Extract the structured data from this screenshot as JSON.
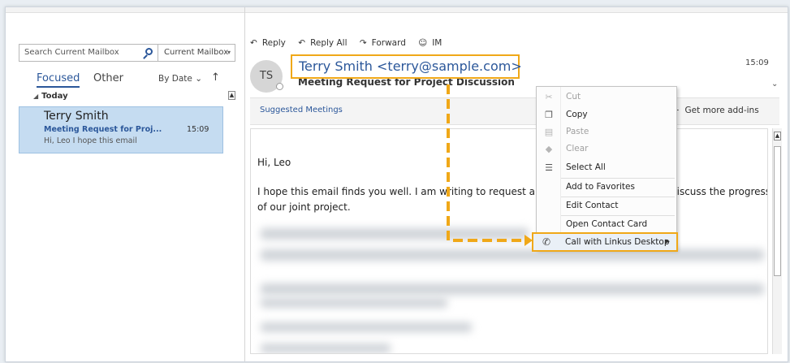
{
  "search": {
    "placeholder": "Search Current Mailbox",
    "scope": "Current Mailbox"
  },
  "tabs": {
    "focused": "Focused",
    "other": "Other"
  },
  "sort": {
    "label": "By Date",
    "arrow": "↑"
  },
  "group": {
    "label": "Today"
  },
  "mail_item": {
    "sender": "Terry Smith",
    "subject": "Meeting Request for Proj...",
    "time": "15:09",
    "preview": "Hi, Leo  I hope this email"
  },
  "actions": {
    "reply": "Reply",
    "reply_all": "Reply All",
    "forward": "Forward",
    "im": "IM"
  },
  "message": {
    "avatar_initials": "TS",
    "sender": "Terry Smith <terry@sample.com>",
    "subject": "Meeting Request for Project Discussion",
    "time": "15:09",
    "suggested": "Suggested Meetings",
    "addins": "Get more add-ins",
    "greeting": "Hi, Leo",
    "line1": "I hope this email finds you well. I am writing to request a meet",
    "line1_end": "discuss the progress",
    "line2": "of our joint project."
  },
  "context_menu": {
    "cut": "Cut",
    "copy": "Copy",
    "paste": "Paste",
    "clear": "Clear",
    "select_all": "Select All",
    "add_favorites": "Add to Favorites",
    "edit_contact": "Edit Contact",
    "open_card": "Open Contact Card",
    "call_linkus": "Call with Linkus Desktop"
  },
  "colors": {
    "accent": "#2b579a",
    "highlight": "#f0a818",
    "selected": "#c5dcf1"
  }
}
